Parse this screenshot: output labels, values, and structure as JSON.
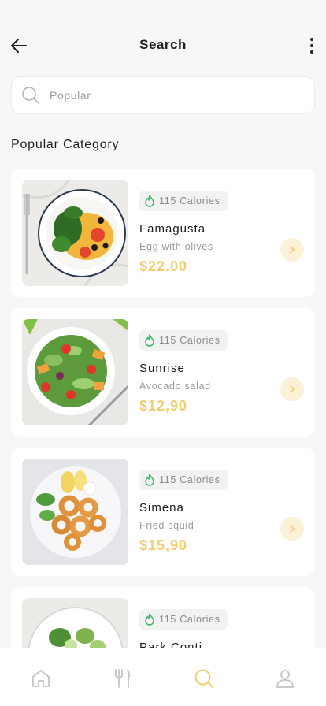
{
  "header": {
    "title": "Search"
  },
  "search": {
    "placeholder": "Popular"
  },
  "section": {
    "title": "Popular Category"
  },
  "colors": {
    "accent": "#f3ce6c",
    "accent_soft": "#fbf1d9",
    "calorie_icon": "#3fb86b"
  },
  "items": [
    {
      "calories": "115 Calories",
      "name": "Famagusta",
      "desc": "Egg with olives",
      "price": "$22.00"
    },
    {
      "calories": "115 Calories",
      "name": "Sunrise",
      "desc": "Avocado salad",
      "price": "$12,90"
    },
    {
      "calories": "115 Calories",
      "name": "Simena",
      "desc": "Fried squid",
      "price": "$15,90"
    },
    {
      "calories": "115 Calories",
      "name": "Park Conti",
      "desc": "",
      "price": ""
    }
  ],
  "nav": [
    {
      "icon": "home-icon"
    },
    {
      "icon": "fork-knife-icon"
    },
    {
      "icon": "search-icon",
      "active": true
    },
    {
      "icon": "user-icon"
    }
  ]
}
